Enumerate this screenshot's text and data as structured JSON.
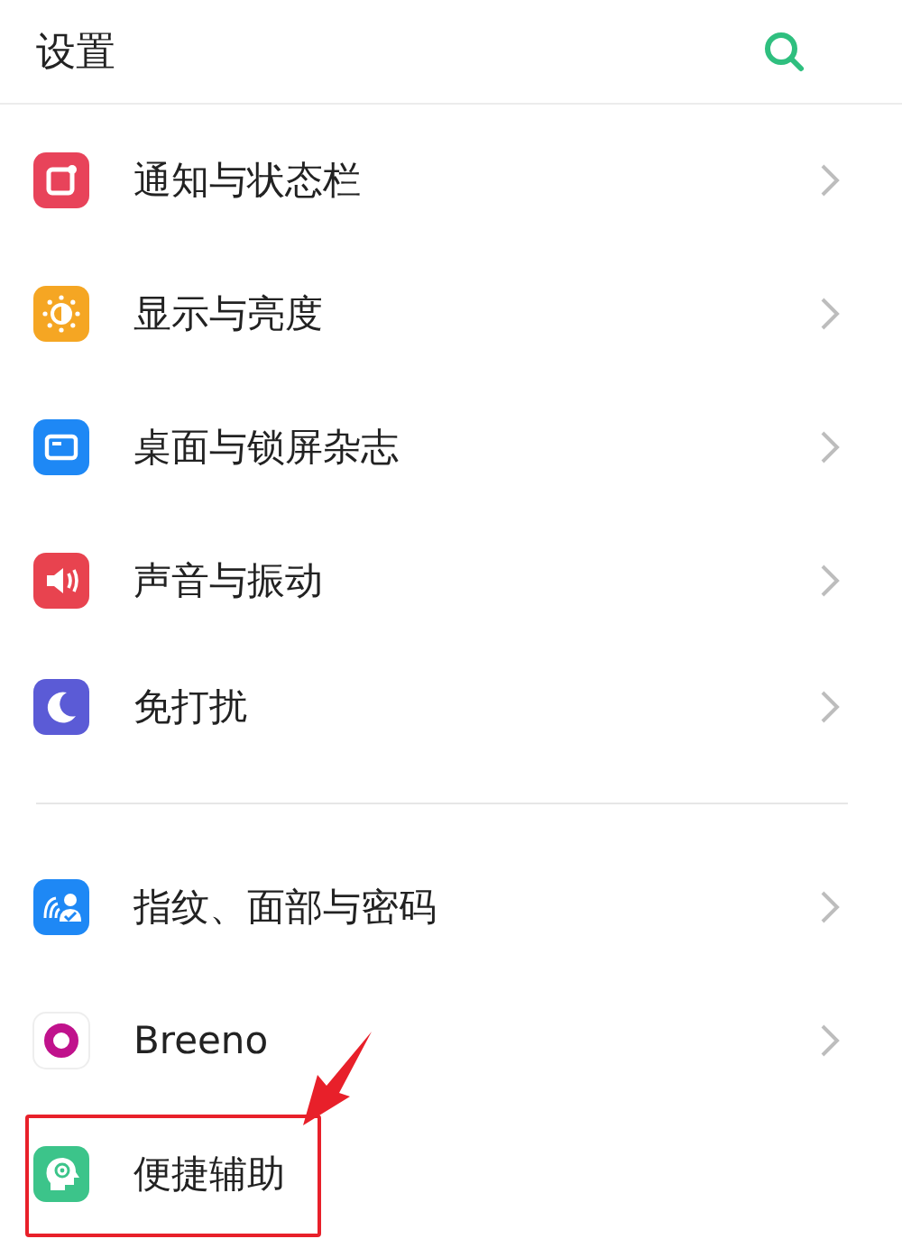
{
  "header": {
    "title": "设置"
  },
  "groups": [
    {
      "items": [
        {
          "label": "通知与状态栏",
          "kind": "notification",
          "color": "#e8435a",
          "chevron": true,
          "highlighted": false
        },
        {
          "label": "显示与亮度",
          "kind": "brightness",
          "color": "#f5a623",
          "chevron": true,
          "highlighted": false
        },
        {
          "label": "桌面与锁屏杂志",
          "kind": "wallpaper",
          "color": "#1e88f5",
          "chevron": true,
          "highlighted": false
        },
        {
          "label": "声音与振动",
          "kind": "sound",
          "color": "#e8434f",
          "chevron": true,
          "highlighted": false
        },
        {
          "label": "免打扰",
          "kind": "moon",
          "color": "#5b5bd6",
          "chevron": true,
          "highlighted": false
        }
      ]
    },
    {
      "items": [
        {
          "label": "指纹、面部与密码",
          "kind": "security",
          "color": "#1e88f5",
          "chevron": true,
          "highlighted": false
        },
        {
          "label": "Breeno",
          "kind": "ring",
          "color": "#c0128c",
          "chevron": true,
          "highlighted": false
        },
        {
          "label": "便捷辅助",
          "kind": "assist",
          "color": "#3cc48a",
          "chevron": false,
          "highlighted": true
        }
      ]
    }
  ]
}
